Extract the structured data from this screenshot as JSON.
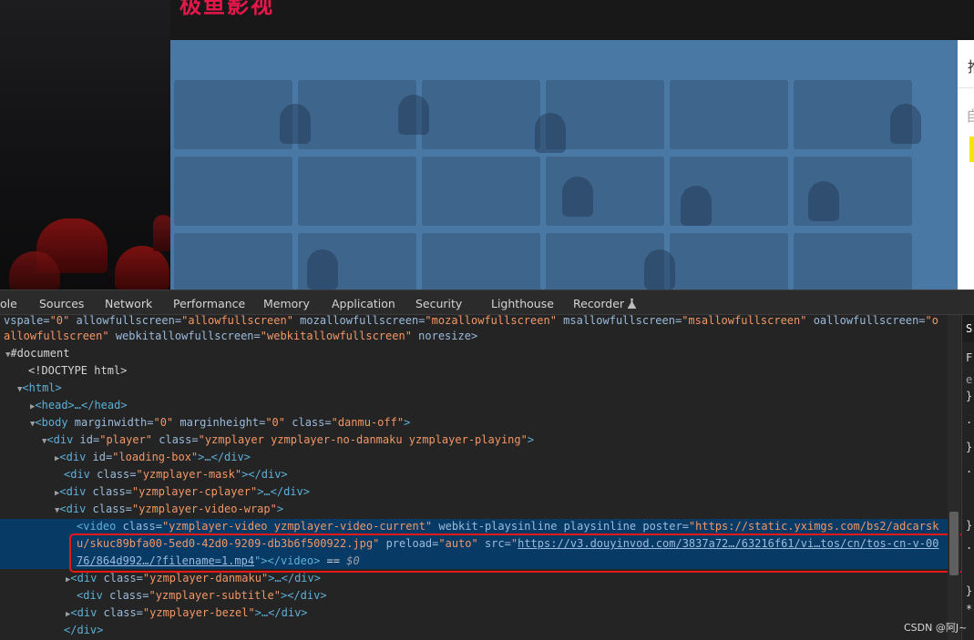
{
  "page": {
    "logo_text": "极鱼影视"
  },
  "right_panel": {
    "heading_fragment": "推",
    "subtext_fragment": "自"
  },
  "devtools": {
    "tabs": [
      "ole",
      "Sources",
      "Network",
      "Performance",
      "Memory",
      "Application",
      "Security",
      "Lighthouse",
      "Recorder"
    ],
    "recorder_icon": "flask-icon",
    "dom_lines": {
      "l0_a": "vspale=",
      "l0_b": "\"0\"",
      "l0_c": " allowfullscreen=",
      "l0_d": "\"allowfullscreen\"",
      "l0_e": " mozallowfullscreen=",
      "l0_f": "\"mozallowfullscreen\"",
      "l0_g": " msallowfullscreen=",
      "l0_h": "\"msallowfullscreen\"",
      "l0_i": " oallowfullscreen=",
      "l0_j": "\"o",
      "l1_a": "allowfullscreen\"",
      "l1_b": " webkitallowfullscreen=",
      "l1_c": "\"webkitallowfullscreen\"",
      "l1_d": " noresize>",
      "document": "#document",
      "doctype": "<!DOCTYPE html>",
      "html": "<html>",
      "head": "<head>…</head>",
      "body_open": "<body ",
      "body_a1": "marginwidth=",
      "body_v1": "\"0\"",
      "body_a2": " marginheight=",
      "body_v2": "\"0\"",
      "body_a3": " class=",
      "body_v3": "\"danmu-off\"",
      "body_close": ">",
      "player_open": "<div ",
      "player_a1": "id=",
      "player_v1": "\"player\"",
      "player_a2": " class=",
      "player_v2": "\"yzmplayer yzmplayer-no-danmaku yzmplayer-playing\"",
      "player_close": ">",
      "loading_open": "<div ",
      "loading_a": "id=",
      "loading_v": "\"loading-box\"",
      "loading_close": ">…</div>",
      "mask_open": "<div ",
      "mask_a": "class=",
      "mask_v": "\"yzmplayer-mask\"",
      "mask_close": "></div>",
      "cplayer_open": "<div ",
      "cplayer_a": "class=",
      "cplayer_v": "\"yzmplayer-cplayer\"",
      "cplayer_close": ">…</div>",
      "wrap_open": "<div ",
      "wrap_a": "class=",
      "wrap_v": "\"yzmplayer-video-wrap\"",
      "wrap_close": ">",
      "video_open": "<video ",
      "video_a1": "class=",
      "video_v1": "\"yzmplayer-video yzmplayer-video-current\"",
      "video_a2": " webkit-playsinline playsinline poster=",
      "video_v2a": "\"https://static.yximgs.com/bs2/adcarsk",
      "video_v2b": "u/skuc89bfa00-5ed0-42d0-9209-db3b6f500922.jpg\"",
      "video_a3": " preload=",
      "video_v3": "\"auto\"",
      "video_a4": " src=",
      "video_q": "\"",
      "video_link1": "https://v3.douyinvod.com/3837a72…/63216f61/vi…tos/cn/tos-cn-v-00",
      "video_link2": "76/864d992…/?filename=1.mp4",
      "video_end": "\"></video>",
      "video_eq": " == ",
      "video_dollar": "$0",
      "danmaku_open": "<div ",
      "danmaku_a": "class=",
      "danmaku_v": "\"yzmplayer-danmaku\"",
      "danmaku_close": ">…</div>",
      "subtitle_open": "<div ",
      "subtitle_a": "class=",
      "subtitle_v": "\"yzmplayer-subtitle\"",
      "subtitle_close": "></div>",
      "bezel_open": "<div ",
      "bezel_a": "class=",
      "bezel_v": "\"yzmplayer-bezel\"",
      "bezel_close": ">…</div>",
      "div_close": "</div>"
    }
  },
  "styles_pane": {
    "chars": [
      "S",
      "F",
      "e",
      "}",
      ".",
      "}",
      ".",
      "}",
      ".",
      "}",
      "*"
    ]
  },
  "watermark": "CSDN @阿J~",
  "colors": {
    "tag": "#5db0d7",
    "attr_name": "#9bbbdc",
    "attr_value": "#f29766",
    "selection": "#083a66",
    "highlight_box": "#e8171a",
    "video_bg": "#4a78a5"
  }
}
